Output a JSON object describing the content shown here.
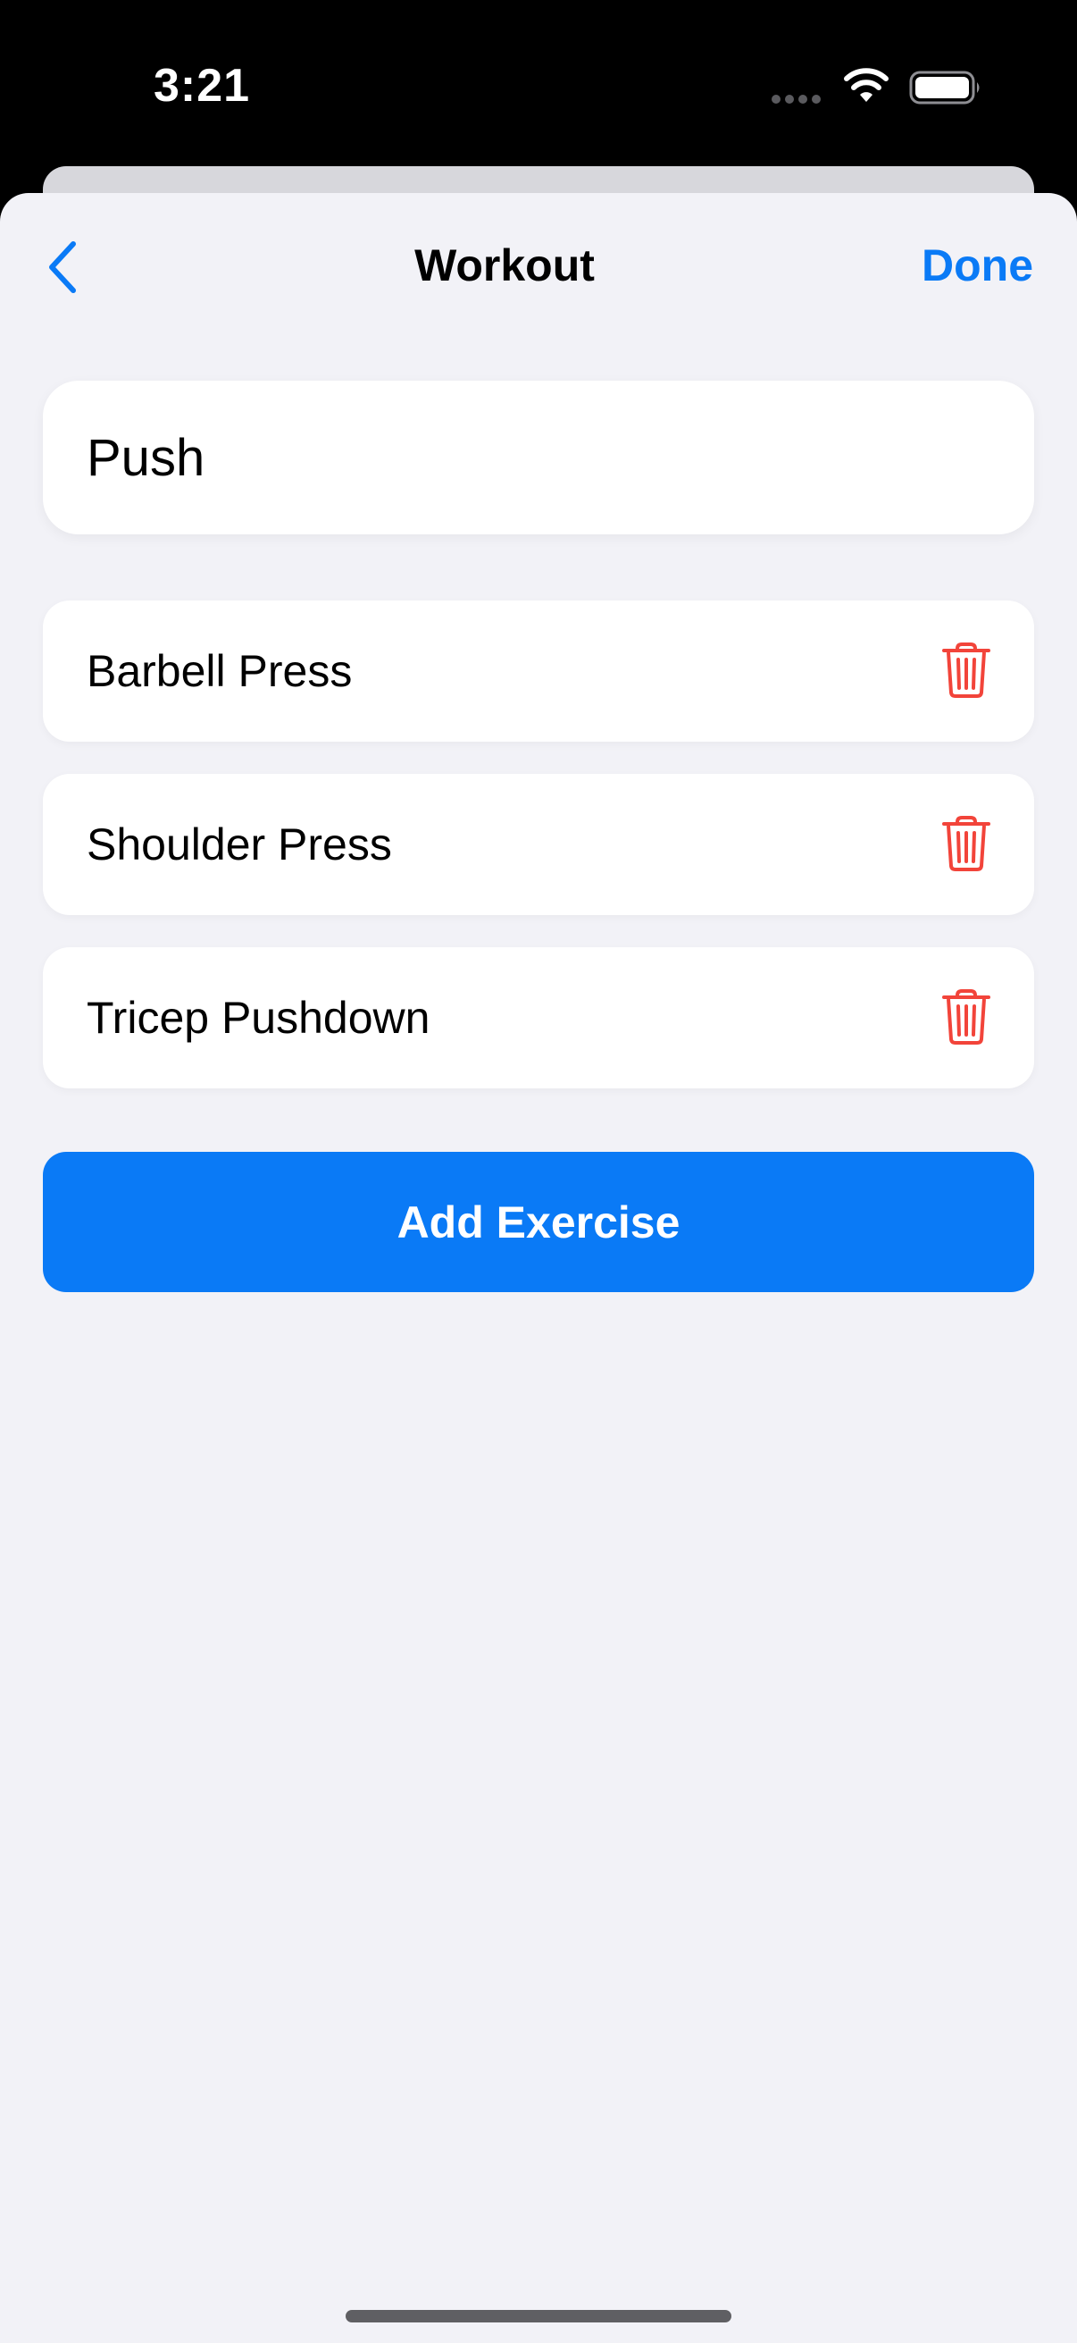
{
  "status_bar": {
    "time": "3:21"
  },
  "nav": {
    "title": "Workout",
    "done_label": "Done"
  },
  "workout": {
    "name": "Push"
  },
  "exercises": [
    {
      "name": "Barbell Press"
    },
    {
      "name": "Shoulder Press"
    },
    {
      "name": "Tricep Pushdown"
    }
  ],
  "actions": {
    "add_exercise_label": "Add Exercise"
  },
  "colors": {
    "accent": "#0a7af6",
    "destructive": "#f2443a",
    "background": "#f2f2f7"
  },
  "icons": {
    "back": "chevron-left-icon",
    "delete": "trash-icon",
    "wifi": "wifi-icon",
    "battery": "battery-icon",
    "signal": "cellular-signal-icon"
  }
}
